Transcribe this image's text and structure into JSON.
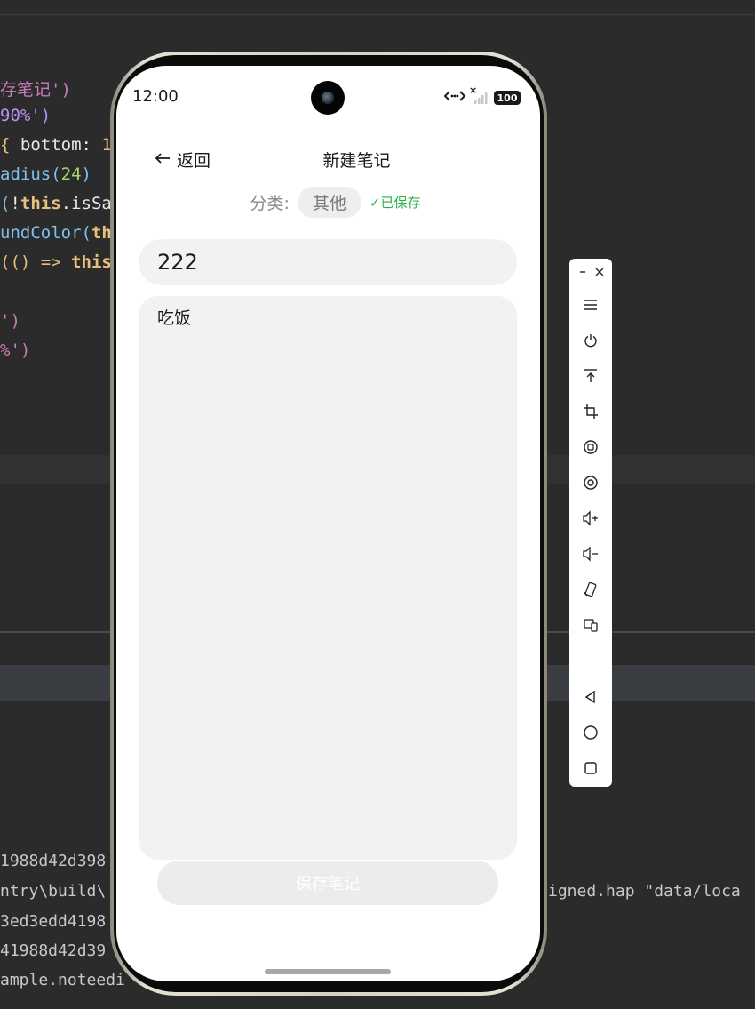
{
  "ide": {
    "code_lines": [
      [
        {
          "t": "存笔记')",
          "c": "c-str"
        }
      ],
      [
        {
          "t": "90%')",
          "c": "c-num"
        }
      ],
      [
        {
          "t": "{ ",
          "c": "c-brace"
        },
        {
          "t": "bottom: ",
          "c": "c-plain"
        },
        {
          "t": "1",
          "c": "c-brace"
        }
      ],
      [
        {
          "t": "adius(",
          "c": "c-fn"
        },
        {
          "t": "24",
          "c": "c-arg"
        },
        {
          "t": ")",
          "c": "c-fn"
        }
      ],
      [
        {
          "t": "(",
          "c": "c-fn"
        },
        {
          "t": "!",
          "c": "c-plain"
        },
        {
          "t": "this",
          "c": "c-kw"
        },
        {
          "t": ".isSa",
          "c": "c-plain"
        }
      ],
      [
        {
          "t": "undColor(",
          "c": "c-fn"
        },
        {
          "t": "th",
          "c": "c-kw"
        }
      ],
      [
        {
          "t": "(() => ",
          "c": "c-brace"
        },
        {
          "t": "this",
          "c": "c-kw"
        }
      ],
      [],
      [
        {
          "t": "')",
          "c": "c-str"
        }
      ],
      [
        {
          "t": "%')",
          "c": "c-str"
        }
      ]
    ],
    "console_lines": [
      {
        "left": "1988d42d398",
        "right": ""
      },
      {
        "left": "ntry\\build\\",
        "right": "igned.hap \"data/loca"
      },
      {
        "left": "3ed3edd4198",
        "right": ""
      },
      {
        "left": "41988d42d39",
        "right": ""
      },
      {
        "left": "ample.noteedi",
        "right": ""
      }
    ]
  },
  "status_bar": {
    "time": "12:00",
    "signal_x": "×",
    "battery": "100"
  },
  "header": {
    "back_label": "返回",
    "title": "新建笔记"
  },
  "category": {
    "label": "分类:",
    "value": "其他",
    "saved_status": "✓已保存"
  },
  "note": {
    "title_value": "222",
    "content_value": "吃饭"
  },
  "save_button": {
    "label": "保存笔记"
  },
  "toolbar": {
    "icons": [
      "menu-icon",
      "power-icon",
      "upload-icon",
      "crop-icon",
      "rotate-icon",
      "at-icon",
      "volume-up-icon",
      "volume-down-icon",
      "rotate-device-icon",
      "multi-device-icon",
      "back-nav-icon",
      "home-nav-icon",
      "recent-apps-icon"
    ]
  }
}
